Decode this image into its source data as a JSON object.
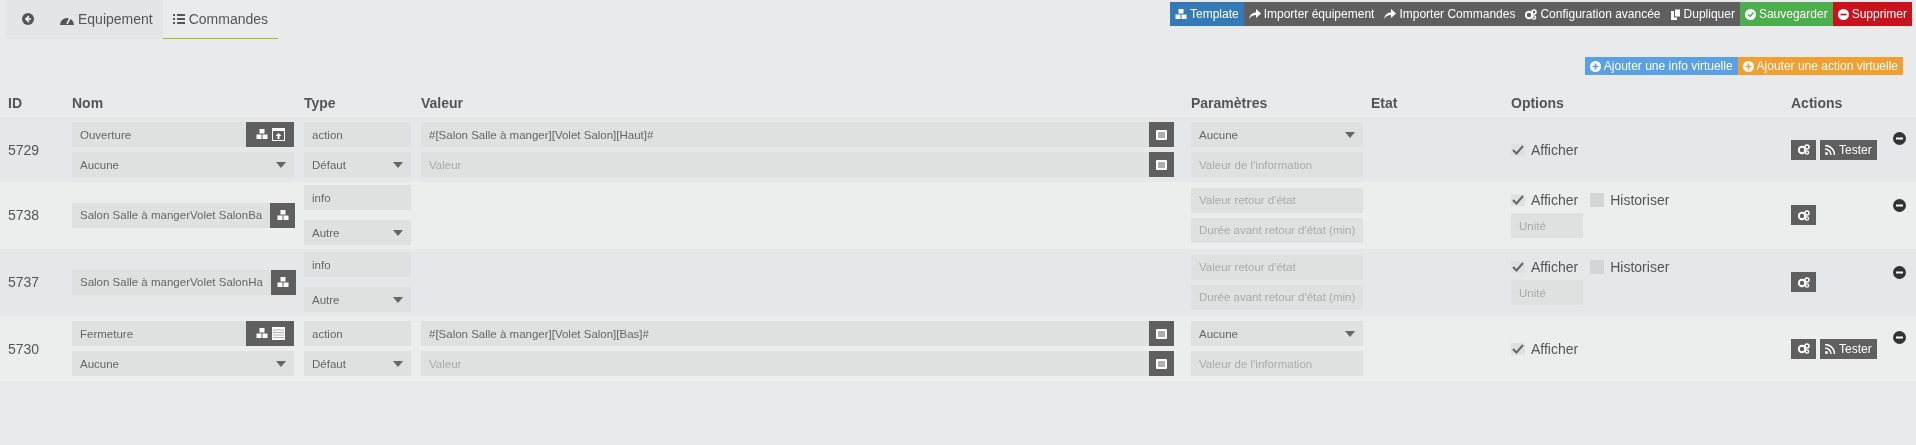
{
  "tabs": [
    {
      "label": "Equipement",
      "selected": false
    },
    {
      "label": "Commandes",
      "selected": true
    }
  ],
  "toolbar": [
    {
      "label": "Template",
      "kind": "primary"
    },
    {
      "label": "Importer équipement",
      "kind": "default"
    },
    {
      "label": "Importer Commandes",
      "kind": "default"
    },
    {
      "label": "Configuration avancée",
      "kind": "default"
    },
    {
      "label": "Dupliquer",
      "kind": "default"
    },
    {
      "label": "Sauvegarder",
      "kind": "success"
    },
    {
      "label": "Supprimer",
      "kind": "danger"
    }
  ],
  "add_buttons": [
    {
      "label": "Ajouter une info virtuelle",
      "kind": "info"
    },
    {
      "label": "Ajouter une action virtuelle",
      "kind": "warning"
    }
  ],
  "columns": [
    "ID",
    "Nom",
    "Type",
    "Valeur",
    "Paramètres",
    "Etat",
    "Options",
    "Actions"
  ],
  "commands": [
    {
      "kind": "action",
      "id": "5729",
      "name": "Ouverture",
      "widget": {
        "kind": "open"
      },
      "generic": "Aucune",
      "type": "action",
      "subtype": "Défaut",
      "value": "#[Salon Salle à manger][Volet Salon][Haut]#",
      "value_placeholder": "Valeur",
      "param_select": "Aucune",
      "param_placeholder": "Valeur de l'information",
      "show": {
        "label": "Afficher",
        "checked": true
      },
      "test": "Tester"
    },
    {
      "kind": "info",
      "id": "5738",
      "name": "Salon Salle à mangerVolet SalonBa",
      "type": "info",
      "subtype": "Autre",
      "return_placeholder": "Valeur retour d'état",
      "delay_placeholder": "Durée avant retour d'état (min)",
      "show": {
        "label": "Afficher",
        "checked": true
      },
      "history": {
        "label": "Historiser",
        "checked": false
      },
      "unit_placeholder": "Unité"
    },
    {
      "kind": "info",
      "id": "5737",
      "name": "Salon Salle à mangerVolet SalonHa",
      "type": "info",
      "subtype": "Autre",
      "return_placeholder": "Valeur retour d'état",
      "delay_placeholder": "Durée avant retour d'état (min)",
      "show": {
        "label": "Afficher",
        "checked": true
      },
      "history": {
        "label": "Historiser",
        "checked": false
      },
      "unit_placeholder": "Unité"
    },
    {
      "kind": "action",
      "id": "5730",
      "name": "Fermeture",
      "widget": {
        "kind": "closed"
      },
      "generic": "Aucune",
      "type": "action",
      "subtype": "Défaut",
      "value": "#[Salon Salle à manger][Volet Salon][Bas]#",
      "value_placeholder": "Valeur",
      "param_select": "Aucune",
      "param_placeholder": "Valeur de l'information",
      "show": {
        "label": "Afficher",
        "checked": true
      },
      "test": "Tester"
    }
  ]
}
